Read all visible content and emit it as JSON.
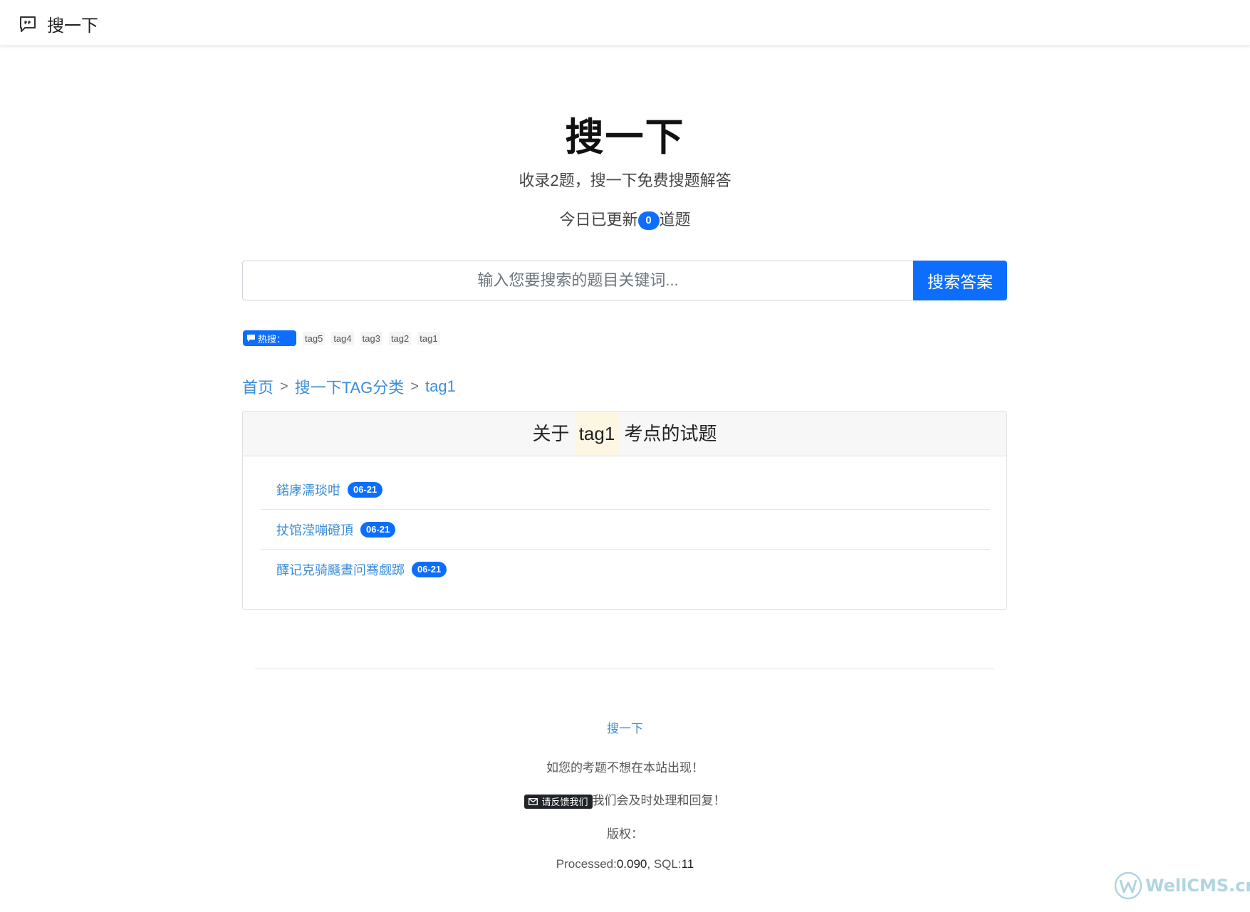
{
  "navbar": {
    "brand_text": "搜一下",
    "brand_icon": "chat-quote-icon"
  },
  "hero": {
    "title": "搜一下",
    "subtitle": "收录2题，搜一下免费搜题解答",
    "today_prefix": "今日已更新",
    "today_count": "0",
    "today_suffix": "道题"
  },
  "search": {
    "placeholder": "输入您要搜索的题目关键词...",
    "button_label": "搜索答案"
  },
  "hot": {
    "label": "热搜：",
    "tags": [
      "tag5",
      "tag4",
      "tag3",
      "tag2",
      "tag1"
    ]
  },
  "breadcrumb": {
    "home": "首页",
    "sep": ">",
    "category": "搜一下TAG分类",
    "current": "tag1"
  },
  "card": {
    "title_prefix": "关于",
    "title_tag": "tag1",
    "title_suffix": "考点的试题",
    "items": [
      {
        "title": "鍩庨濡琰咁",
        "date": "06-21"
      },
      {
        "title": "扙馆滢嘣磴頂",
        "date": "06-21"
      },
      {
        "title": "醳记克骑颾晝问骞觑踯",
        "date": "06-21"
      }
    ]
  },
  "footer": {
    "site_link": "搜一下",
    "notice": "如您的考题不想在本站出现！",
    "feedback_button": "请反馈我们",
    "feedback_suffix": "我们会及时处理和回复！",
    "copyright": "版权：",
    "processed_label": "Processed:",
    "processed_value": "0.090",
    "sql_label": ", SQL:",
    "sql_value": "11"
  },
  "watermark": {
    "text": "WellCMS.cn"
  },
  "colors": {
    "primary": "#0d6efd",
    "link": "#3b8ed8",
    "dark": "#212529"
  }
}
